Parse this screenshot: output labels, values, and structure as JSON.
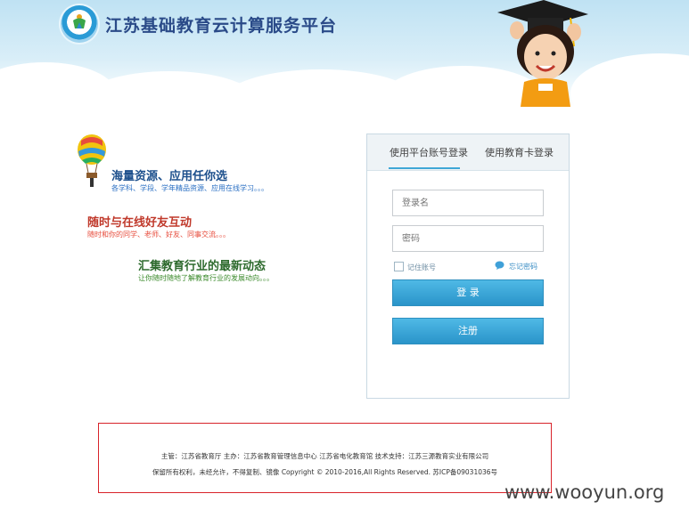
{
  "header": {
    "title": "江苏基础教育云计算服务平台"
  },
  "promo": [
    {
      "title": "海量资源、应用任你选",
      "subtitle": "各学科、学段、学年精品资源、应用在线学习。。。",
      "color": "#1c4f8c",
      "sub_color": "#2a6fc3"
    },
    {
      "title": "随时与在线好友互动",
      "subtitle": "随时和你的同学、老师、好友、同事交流。。。",
      "color": "#c0392b",
      "sub_color": "#e74c3c"
    },
    {
      "title": "汇集教育行业的最新动态",
      "subtitle": "让你随时随地了解教育行业的发展动向。。。",
      "color": "#2d6a2d",
      "sub_color": "#3a8a2a"
    }
  ],
  "login": {
    "tabs": [
      "使用平台账号登录",
      "使用教育卡登录"
    ],
    "username_placeholder": "登录名",
    "password_placeholder": "密码",
    "remember_label": "记住账号",
    "forgot_label": "忘记密码",
    "login_button": "登 录",
    "register_button": "注册"
  },
  "footer": {
    "line1": "主管：江苏省教育厅   主办：江苏省教育管理信息中心 江苏省电化教育馆   技术支持：江苏三源教育实业有限公司",
    "line2": "保留所有权利，未经允许，不得复制、镜像 Copyright © 2010-2016,All Rights Reserved.    苏ICP备09031036号"
  },
  "watermark": "www.wooyun.org"
}
